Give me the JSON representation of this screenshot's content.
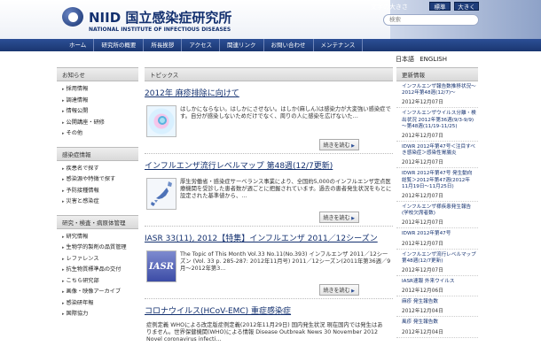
{
  "header": {
    "logo_jp": "NIID 国立感染症研究所",
    "logo_en": "NATIONAL INSTITUTE OF INFECTIOUS DISEASES",
    "font_size_label": "文字の大きさ",
    "font_std": "標準",
    "font_big": "大きく",
    "search_placeholder": "検索"
  },
  "nav": [
    "ホーム",
    "研究所の概要",
    "所長挨拶",
    "アクセス",
    "関連リンク",
    "お問い合わせ",
    "メンテナンス"
  ],
  "lang": {
    "jp": "日本語",
    "en": "ENGLISH"
  },
  "left": {
    "sections": [
      {
        "title": "お知らせ",
        "items": [
          "採用情報",
          "調達情報",
          "情報公開",
          "公開講座・研修",
          "その他"
        ]
      },
      {
        "title": "感染症情報",
        "items": [
          "疾患名で探す",
          "感染源や特徴で探す",
          "予防接種情報",
          "災害と感染症"
        ]
      },
      {
        "title": "研究・検査・病原体管理",
        "items": [
          "研究情報",
          "生物学的製剤の品質管理",
          "レファレンス",
          "抗生物質標準品の交付",
          "こちら研究部",
          "画像・映像アーカイブ",
          "感染研年報",
          "国際協力"
        ]
      }
    ]
  },
  "main": {
    "topics_title": "トピックス",
    "read_more": "続きを読む",
    "news": [
      {
        "title": "2012年 麻疹排除に向けて",
        "body": "はしかにならない。はしかにさせない。はしか(麻しん)は感染力が大変強い感染症です。自分が感染しないためだけでなく、周りの人に感染を広げないた…"
      },
      {
        "title": "インフルエンザ流行レベルマップ 第48週(12/7更新)",
        "body": "厚生労働省・感染症サーベランス事業により、全国約5,000のインフルエンザ定点医療機関を受診した患者数が週ごとに把握されています。過去の患者発生状況をもとに設定された基準値から、…"
      },
      {
        "title": "IASR 33(11), 2012【特集】インフルエンザ 2011／12シーズン",
        "body": "The Topic of This Month Vol.33 No.11(No.393) インフルエンザ 2011／12シーズン (Vol. 33 p. 285-287: 2012年11月号) 2011／12シーズン(2011年第36週／9月〜2012年第3…"
      },
      {
        "title": "コロナウイルス(HCoV-EMC) 重症感染症",
        "body": "症例定義 WHOによる改定版症例定義(2012年11月29日) 国内発生状況 現在国内では発生はありません。世界保健機関(WHO)による情報 Disease Outbreak News 30 November 2012 Novel coronavirus infecti…"
      }
    ]
  },
  "right": {
    "title": "更新情報",
    "items": [
      {
        "title": "インフルエンザ報告数推移状況～2012年第48週(12/7)～",
        "date": "2012年12月07日"
      },
      {
        "title": "インフルエンザウイルス分離・検出状況 2012年第36週(9/3-9/9)～第48週(11/19-11/25)",
        "date": "2012年12月07日"
      },
      {
        "title": "IDWR 2012年第47号＜注目すべき感染症＞感染性胃腸炎",
        "date": "2012年12月07日"
      },
      {
        "title": "IDWR 2012年第47号 発生動向総覧＞2012年第47週(2012年11月19日～11月25日)",
        "date": "2012年12月07日"
      },
      {
        "title": "インフルエンザ様疾患発生報告(学校欠席者数)",
        "date": "2012年12月07日"
      },
      {
        "title": "IDWR 2012年第47号",
        "date": "2012年12月07日"
      },
      {
        "title": "インフルエンザ流行レベルマップ 第48週(12/7更新)",
        "date": "2012年12月07日"
      },
      {
        "title": "IASR速報 外来ウイルス",
        "date": "2012年12月06日"
      },
      {
        "title": "麻疹 発生報告数",
        "date": "2012年12月04日"
      },
      {
        "title": "風疹 発生報告数",
        "date": "2012年12月04日"
      }
    ]
  }
}
